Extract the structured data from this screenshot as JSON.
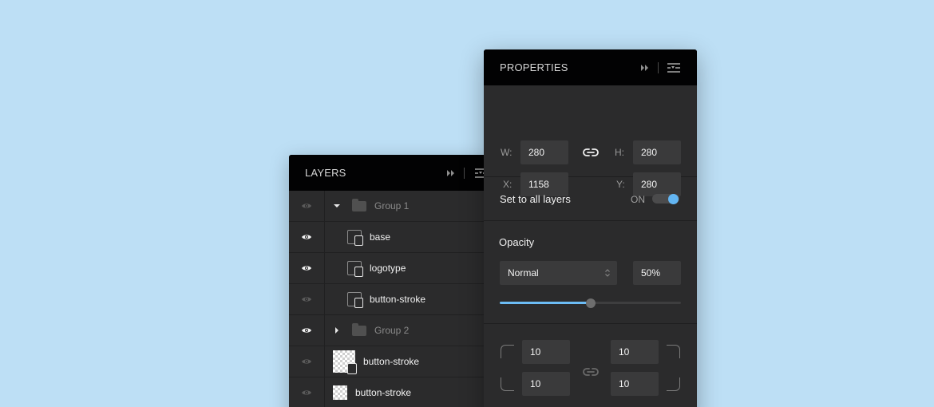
{
  "layers": {
    "title": "LAYERS",
    "rows": [
      {
        "name": "Group 1",
        "visible": false,
        "kind": "group",
        "expanded": true,
        "dim": true
      },
      {
        "name": "base",
        "visible": true,
        "kind": "link-layer"
      },
      {
        "name": "logotype",
        "visible": true,
        "kind": "file-layer"
      },
      {
        "name": "button-stroke",
        "visible": false,
        "kind": "shape-layer"
      },
      {
        "name": "Group 2",
        "visible": true,
        "kind": "group",
        "expanded": false,
        "dim": true
      },
      {
        "name": "button-stroke",
        "visible": false,
        "kind": "image-layer"
      },
      {
        "name": "button-stroke",
        "visible": false,
        "kind": "image-layer"
      }
    ]
  },
  "properties": {
    "title": "PROPERTIES",
    "w_label": "W:",
    "w_value": "280",
    "h_label": "H:",
    "h_value": "280",
    "x_label": "X:",
    "x_value": "1158",
    "y_label": "Y:",
    "y_value": "280",
    "set_all_label": "Set to all layers",
    "set_all_state": "ON",
    "opacity_label": "Opacity",
    "blend_mode": "Normal",
    "opacity_value": "50%",
    "opacity_slider_fraction": 0.5,
    "corner_top_left": "10",
    "corner_top_right": "10",
    "corner_bottom_left": "10",
    "corner_bottom_right": "10"
  },
  "colors": {
    "background": "#bddff5",
    "accent": "#6cbcf5",
    "panel": "#2b2b2c",
    "header": "#020203"
  }
}
